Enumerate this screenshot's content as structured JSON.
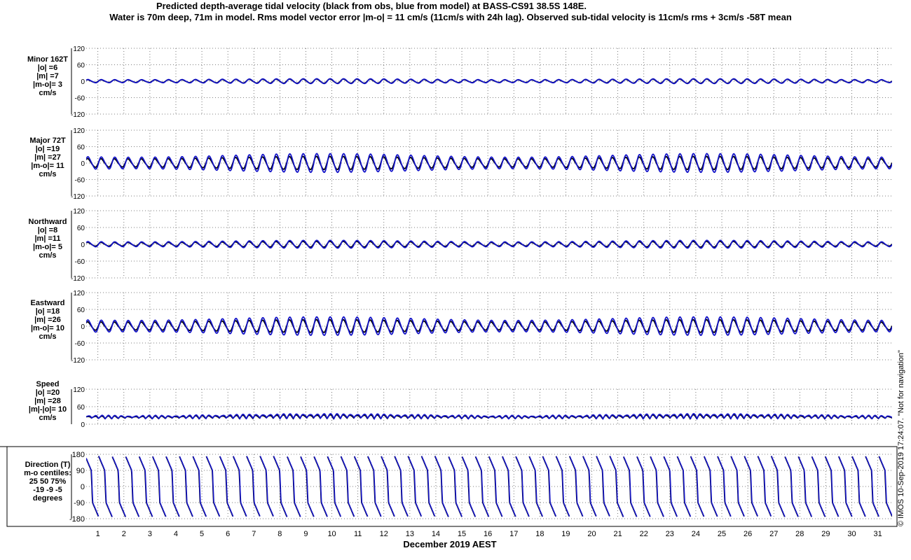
{
  "title_line1": "Predicted depth-average tidal velocity (black from obs, blue from model) at BASS-CS91 38.5S 148E.",
  "title_line2": "Water is 70m deep, 71m in model. Rms model vector error |m-o| = 11 cm/s (11cm/s with 24h lag). Observed sub-tidal velocity is 11cm/s rms + 3cm/s -58T mean",
  "credit": "© IMOS 10-Sep-2019 17:24:07. \"Not for navigation\"",
  "colors": {
    "obs": "#000000",
    "model": "#1515c8",
    "grid": "#555555"
  },
  "chart_data": {
    "type": "line",
    "xlabel": "December 2019 AEST",
    "x_ticks": [
      "1",
      "2",
      "3",
      "4",
      "5",
      "6",
      "7",
      "8",
      "9",
      "10",
      "11",
      "12",
      "13",
      "14",
      "15",
      "16",
      "17",
      "18",
      "19",
      "20",
      "21",
      "22",
      "23",
      "24",
      "25",
      "26",
      "27",
      "28",
      "29",
      "30",
      "31"
    ],
    "xlim": [
      0.55,
      31.55
    ],
    "tidal_period_days": 0.5175,
    "series_names": [
      "obs",
      "model"
    ],
    "panels": [
      {
        "name": "minor",
        "label": [
          "Minor 162T",
          "|o| =6",
          "|m| =7",
          "|m-o|= 3",
          "cm/s"
        ],
        "ylim": [
          -120,
          120
        ],
        "yticks": [
          "120",
          "60",
          "0",
          "-60",
          "-120"
        ],
        "amplitude_obs": 6,
        "amplitude_model": 7,
        "offset": 0
      },
      {
        "name": "major",
        "label": [
          "Major 72T",
          "|o| =19",
          "|m| =27",
          "|m-o|= 11",
          "cm/s"
        ],
        "ylim": [
          -120,
          120
        ],
        "yticks": [
          "120",
          "60",
          "0",
          "-60",
          "-120"
        ],
        "amplitude_obs": 19,
        "amplitude_model": 27,
        "offset": 0
      },
      {
        "name": "northward",
        "label": [
          "Northward",
          "|o| =8",
          "|m| =11",
          "|m-o|= 5",
          "cm/s"
        ],
        "ylim": [
          -120,
          120
        ],
        "yticks": [
          "120",
          "60",
          "0",
          "-60",
          "-120"
        ],
        "amplitude_obs": 8,
        "amplitude_model": 11,
        "offset": 0
      },
      {
        "name": "eastward",
        "label": [
          "Eastward",
          "|o| =18",
          "|m| =26",
          "|m-o|= 10",
          "cm/s"
        ],
        "ylim": [
          -120,
          120
        ],
        "yticks": [
          "120",
          "60",
          "0",
          "-60",
          "-120"
        ],
        "amplitude_obs": 18,
        "amplitude_model": 26,
        "offset": 0
      },
      {
        "name": "speed",
        "label": [
          "Speed",
          "|o| =20",
          "|m| =28",
          "|m|-|o|= 10",
          "cm/s"
        ],
        "ylim": [
          0,
          120
        ],
        "yticks": [
          "120",
          "60",
          "0"
        ],
        "amplitude_obs": 10,
        "amplitude_model": 13,
        "offset": 20
      },
      {
        "name": "direction",
        "label": [
          "Direction (T)",
          "m-o centiles:",
          "25  50  75%",
          "-19  -9  -5",
          "degrees"
        ],
        "ylim": [
          -180,
          180
        ],
        "yticks": [
          "180",
          "90",
          "0",
          "-90",
          "-180"
        ]
      }
    ]
  }
}
